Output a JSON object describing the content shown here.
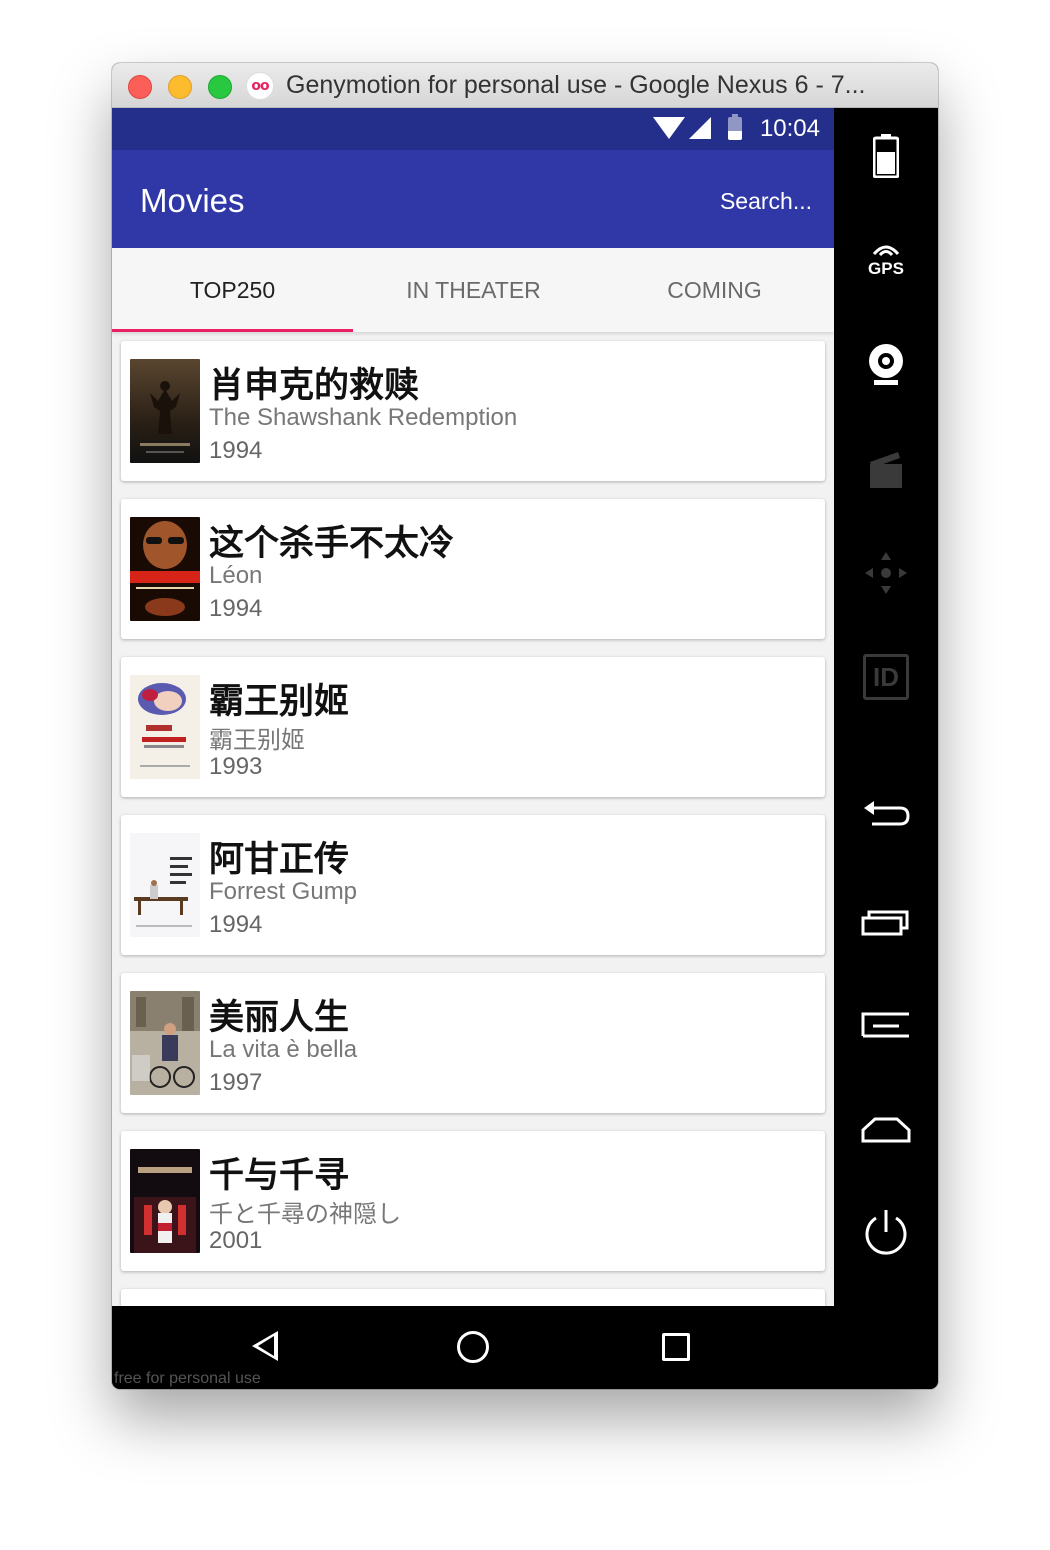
{
  "window": {
    "title": "Genymotion for personal use - Google Nexus 6 - 7..."
  },
  "status_bar": {
    "time": "10:04"
  },
  "app_bar": {
    "title": "Movies",
    "search_label": "Search..."
  },
  "tabs": [
    {
      "label": "TOP250",
      "active": true
    },
    {
      "label": "IN THEATER",
      "active": false
    },
    {
      "label": "COMING",
      "active": false
    }
  ],
  "movies": [
    {
      "title": "肖申克的救赎",
      "original_title": "The Shawshank Redemption",
      "year": "1994"
    },
    {
      "title": "这个杀手不太冷",
      "original_title": "Léon",
      "year": "1994"
    },
    {
      "title": "霸王别姬",
      "original_title": "霸王别姬",
      "year": "1993"
    },
    {
      "title": "阿甘正传",
      "original_title": "Forrest Gump",
      "year": "1994"
    },
    {
      "title": "美丽人生",
      "original_title": "La vita è bella",
      "year": "1997"
    },
    {
      "title": "千与千寻",
      "original_title": "千と千尋の神隠し",
      "year": "2001"
    }
  ],
  "sidebar_icons": [
    "battery-icon",
    "gps-icon",
    "webcam-icon",
    "clapperboard-icon",
    "dpad-icon",
    "id-icon",
    "back-arrow-icon",
    "recent-apps-icon",
    "menu-icon",
    "home-icon",
    "power-icon",
    "more-icon"
  ],
  "sidebar": {
    "gps_label": "GPS",
    "id_label": "ID"
  },
  "footer": {
    "watermark": "free for personal use"
  },
  "colors": {
    "status_bar": "#232f8a",
    "app_bar": "#3038a8",
    "tab_indicator": "#e91e63"
  }
}
